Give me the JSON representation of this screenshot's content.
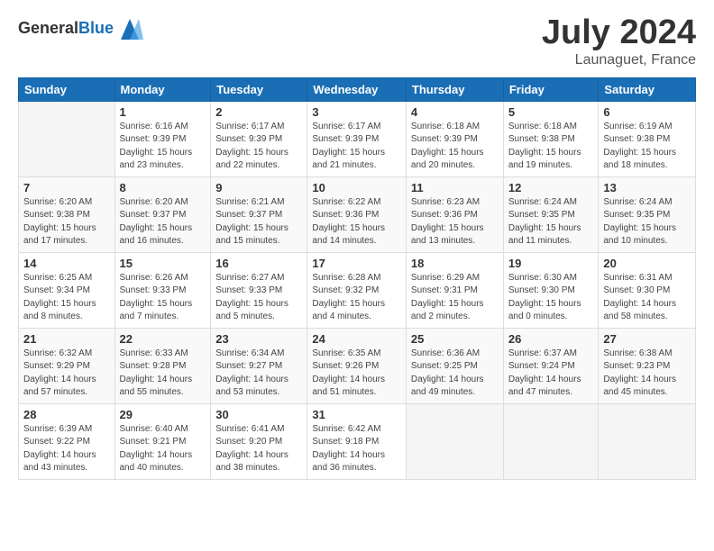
{
  "header": {
    "logo": {
      "general": "General",
      "blue": "Blue"
    },
    "month": "July 2024",
    "location": "Launaguet, France"
  },
  "days_of_week": [
    "Sunday",
    "Monday",
    "Tuesday",
    "Wednesday",
    "Thursday",
    "Friday",
    "Saturday"
  ],
  "weeks": [
    [
      {
        "day": "",
        "info": ""
      },
      {
        "day": "1",
        "info": "Sunrise: 6:16 AM\nSunset: 9:39 PM\nDaylight: 15 hours\nand 23 minutes."
      },
      {
        "day": "2",
        "info": "Sunrise: 6:17 AM\nSunset: 9:39 PM\nDaylight: 15 hours\nand 22 minutes."
      },
      {
        "day": "3",
        "info": "Sunrise: 6:17 AM\nSunset: 9:39 PM\nDaylight: 15 hours\nand 21 minutes."
      },
      {
        "day": "4",
        "info": "Sunrise: 6:18 AM\nSunset: 9:39 PM\nDaylight: 15 hours\nand 20 minutes."
      },
      {
        "day": "5",
        "info": "Sunrise: 6:18 AM\nSunset: 9:38 PM\nDaylight: 15 hours\nand 19 minutes."
      },
      {
        "day": "6",
        "info": "Sunrise: 6:19 AM\nSunset: 9:38 PM\nDaylight: 15 hours\nand 18 minutes."
      }
    ],
    [
      {
        "day": "7",
        "info": "Sunrise: 6:20 AM\nSunset: 9:38 PM\nDaylight: 15 hours\nand 17 minutes."
      },
      {
        "day": "8",
        "info": "Sunrise: 6:20 AM\nSunset: 9:37 PM\nDaylight: 15 hours\nand 16 minutes."
      },
      {
        "day": "9",
        "info": "Sunrise: 6:21 AM\nSunset: 9:37 PM\nDaylight: 15 hours\nand 15 minutes."
      },
      {
        "day": "10",
        "info": "Sunrise: 6:22 AM\nSunset: 9:36 PM\nDaylight: 15 hours\nand 14 minutes."
      },
      {
        "day": "11",
        "info": "Sunrise: 6:23 AM\nSunset: 9:36 PM\nDaylight: 15 hours\nand 13 minutes."
      },
      {
        "day": "12",
        "info": "Sunrise: 6:24 AM\nSunset: 9:35 PM\nDaylight: 15 hours\nand 11 minutes."
      },
      {
        "day": "13",
        "info": "Sunrise: 6:24 AM\nSunset: 9:35 PM\nDaylight: 15 hours\nand 10 minutes."
      }
    ],
    [
      {
        "day": "14",
        "info": "Sunrise: 6:25 AM\nSunset: 9:34 PM\nDaylight: 15 hours\nand 8 minutes."
      },
      {
        "day": "15",
        "info": "Sunrise: 6:26 AM\nSunset: 9:33 PM\nDaylight: 15 hours\nand 7 minutes."
      },
      {
        "day": "16",
        "info": "Sunrise: 6:27 AM\nSunset: 9:33 PM\nDaylight: 15 hours\nand 5 minutes."
      },
      {
        "day": "17",
        "info": "Sunrise: 6:28 AM\nSunset: 9:32 PM\nDaylight: 15 hours\nand 4 minutes."
      },
      {
        "day": "18",
        "info": "Sunrise: 6:29 AM\nSunset: 9:31 PM\nDaylight: 15 hours\nand 2 minutes."
      },
      {
        "day": "19",
        "info": "Sunrise: 6:30 AM\nSunset: 9:30 PM\nDaylight: 15 hours\nand 0 minutes."
      },
      {
        "day": "20",
        "info": "Sunrise: 6:31 AM\nSunset: 9:30 PM\nDaylight: 14 hours\nand 58 minutes."
      }
    ],
    [
      {
        "day": "21",
        "info": "Sunrise: 6:32 AM\nSunset: 9:29 PM\nDaylight: 14 hours\nand 57 minutes."
      },
      {
        "day": "22",
        "info": "Sunrise: 6:33 AM\nSunset: 9:28 PM\nDaylight: 14 hours\nand 55 minutes."
      },
      {
        "day": "23",
        "info": "Sunrise: 6:34 AM\nSunset: 9:27 PM\nDaylight: 14 hours\nand 53 minutes."
      },
      {
        "day": "24",
        "info": "Sunrise: 6:35 AM\nSunset: 9:26 PM\nDaylight: 14 hours\nand 51 minutes."
      },
      {
        "day": "25",
        "info": "Sunrise: 6:36 AM\nSunset: 9:25 PM\nDaylight: 14 hours\nand 49 minutes."
      },
      {
        "day": "26",
        "info": "Sunrise: 6:37 AM\nSunset: 9:24 PM\nDaylight: 14 hours\nand 47 minutes."
      },
      {
        "day": "27",
        "info": "Sunrise: 6:38 AM\nSunset: 9:23 PM\nDaylight: 14 hours\nand 45 minutes."
      }
    ],
    [
      {
        "day": "28",
        "info": "Sunrise: 6:39 AM\nSunset: 9:22 PM\nDaylight: 14 hours\nand 43 minutes."
      },
      {
        "day": "29",
        "info": "Sunrise: 6:40 AM\nSunset: 9:21 PM\nDaylight: 14 hours\nand 40 minutes."
      },
      {
        "day": "30",
        "info": "Sunrise: 6:41 AM\nSunset: 9:20 PM\nDaylight: 14 hours\nand 38 minutes."
      },
      {
        "day": "31",
        "info": "Sunrise: 6:42 AM\nSunset: 9:18 PM\nDaylight: 14 hours\nand 36 minutes."
      },
      {
        "day": "",
        "info": ""
      },
      {
        "day": "",
        "info": ""
      },
      {
        "day": "",
        "info": ""
      }
    ]
  ]
}
